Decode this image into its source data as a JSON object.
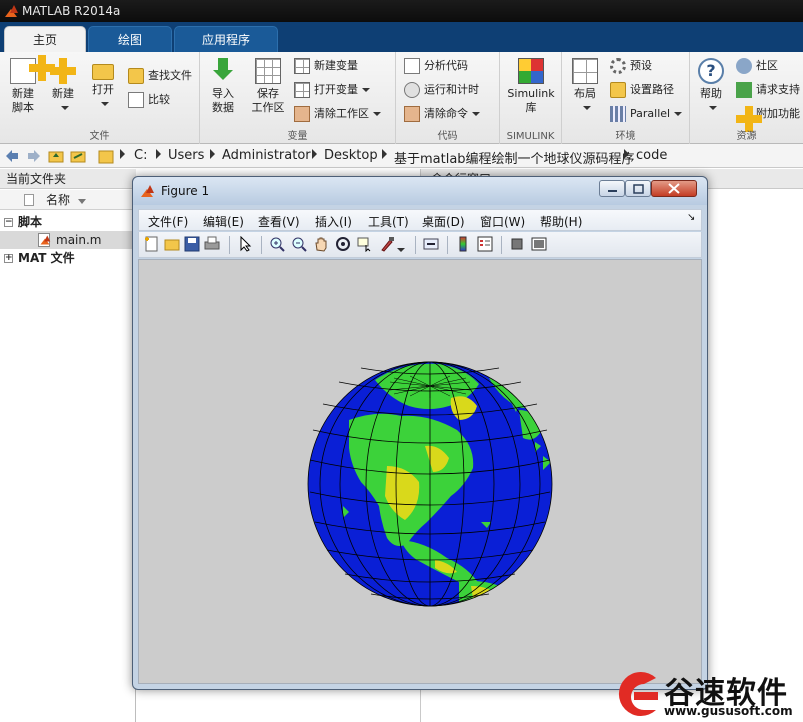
{
  "app": {
    "title": "MATLAB R2014a"
  },
  "tabs": [
    {
      "label": "主页",
      "active": true
    },
    {
      "label": "绘图",
      "active": false
    },
    {
      "label": "应用程序",
      "active": false
    }
  ],
  "ribbon": {
    "file": {
      "label": "文件",
      "new_script": [
        "新建",
        "脚本"
      ],
      "new": "新建",
      "open": "打开",
      "find_files": "查找文件",
      "compare": "比较"
    },
    "variable": {
      "label": "变量",
      "import": [
        "导入",
        "数据"
      ],
      "save_ws": [
        "保存",
        "工作区"
      ],
      "new_var": "新建变量",
      "open_var": "打开变量",
      "clear_ws": "清除工作区"
    },
    "code": {
      "label": "代码",
      "analyze": "分析代码",
      "run_time": "运行和计时",
      "clear_cmd": "清除命令"
    },
    "simulink": {
      "label": "SIMULINK",
      "lib": [
        "Simulink",
        "库"
      ]
    },
    "env": {
      "label": "环境",
      "layout": "布局",
      "prefs": "预设",
      "set_path": "设置路径",
      "parallel": "Parallel"
    },
    "resources": {
      "label": "资源",
      "help": "帮助",
      "community": "社区",
      "support": "请求支持",
      "addons": "附加功能"
    }
  },
  "address": {
    "crumbs": [
      "C:",
      "Users",
      "Administrator",
      "Desktop",
      "基于matlab编程绘制一个地球仪源码程序",
      "code"
    ]
  },
  "filepanel": {
    "title": "当前文件夹",
    "column": "名称",
    "groups": [
      {
        "label": "脚本",
        "expander": "−"
      },
      {
        "label": "main.m"
      },
      {
        "label": "MAT 文件",
        "expander": "+"
      }
    ]
  },
  "rightpanel": {
    "title": "命令行窗口"
  },
  "figure": {
    "title": "Figure 1",
    "menu": [
      "文件(F)",
      "编辑(E)",
      "查看(V)",
      "插入(I)",
      "工具(T)",
      "桌面(D)",
      "窗口(W)",
      "帮助(H)"
    ]
  },
  "watermark": {
    "text": "谷速软件",
    "url": "www.gususoft.com"
  },
  "colors": {
    "tabstrip": "#0e3f74",
    "ocean": "#0a1fd6",
    "land_green": "#3cd23a",
    "land_yellow": "#d9d91b",
    "canvas": "#cccccc"
  }
}
